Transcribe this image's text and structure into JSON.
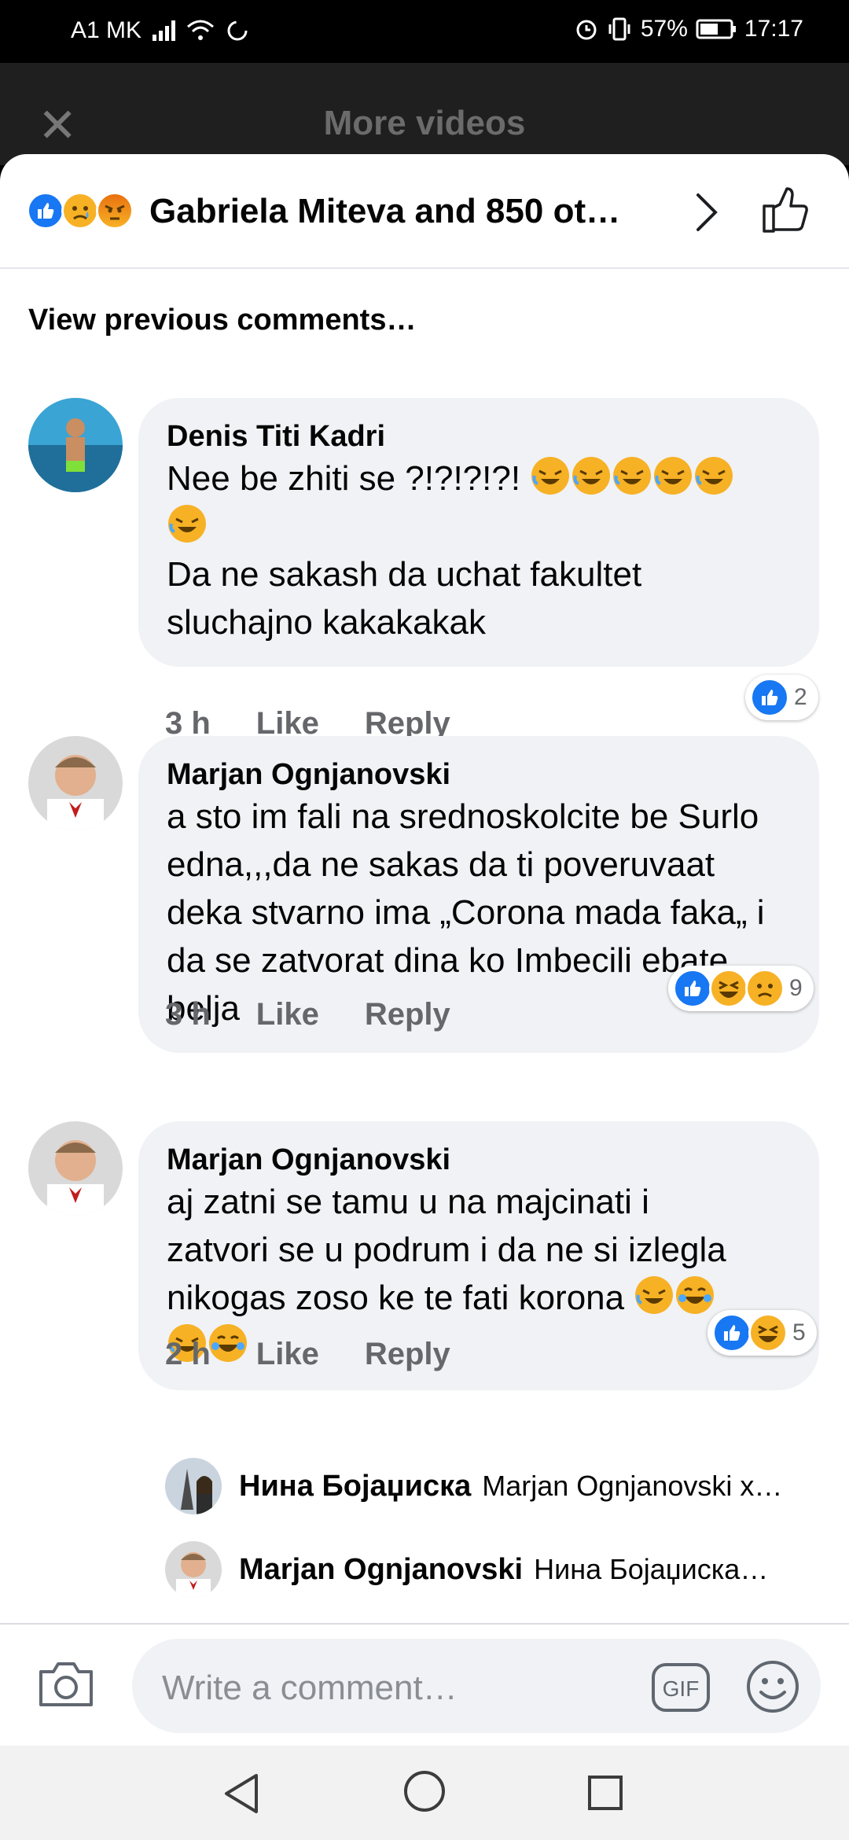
{
  "status_bar": {
    "carrier": "A1 MK",
    "battery": "57%",
    "time": "17:17"
  },
  "background_header": {
    "close_icon": "close-icon",
    "title": "More videos"
  },
  "reactions_summary": {
    "icons": [
      "like",
      "sad",
      "angry"
    ],
    "text": "Gabriela Miteva and 850 ot…"
  },
  "view_previous": "View previous comments…",
  "comments": [
    {
      "author": "Denis Titi Kadri",
      "line1": "Nee be zhiti se ?!?!?!?! ",
      "line3": "Da ne sakash da uchat fakultet",
      "line4": "sluchajno kakakakak",
      "time": "3 h",
      "like": "Like",
      "reply": "Reply",
      "reaction_count": "2"
    },
    {
      "author": "Marjan Ognjanovski",
      "text": "a sto im fali na srednoskolcite be Surlo edna,,,da  ne sakas da ti poveruvaat deka stvarno ima „Corona mada faka„ i da se zatvorat dina ko Imbecili ebate belja",
      "time": "3 h",
      "like": "Like",
      "reply": "Reply",
      "reaction_count": "9"
    },
    {
      "author": "Marjan Ognjanovski",
      "line1": "aj zatni se tamu u na majcinati i",
      "line2": "zatvori se u podrum i da ne si izlegla",
      "line3": "nikogas zoso ke te fati korona ",
      "time": "2 h",
      "like": "Like",
      "reply": "Reply",
      "reaction_count": "5"
    }
  ],
  "replies": [
    {
      "author": "Нина Бојаџиска",
      "snippet": "Marjan Ognjanovski х…"
    },
    {
      "author": "Marjan Ognjanovski",
      "snippet": "Нина Бојаџиска…"
    }
  ],
  "composer": {
    "placeholder": "Write a comment…",
    "gif_label": "GIF"
  },
  "colors": {
    "accent": "#1877f2",
    "bubble": "#f0f2f5",
    "muted": "#65676b"
  }
}
